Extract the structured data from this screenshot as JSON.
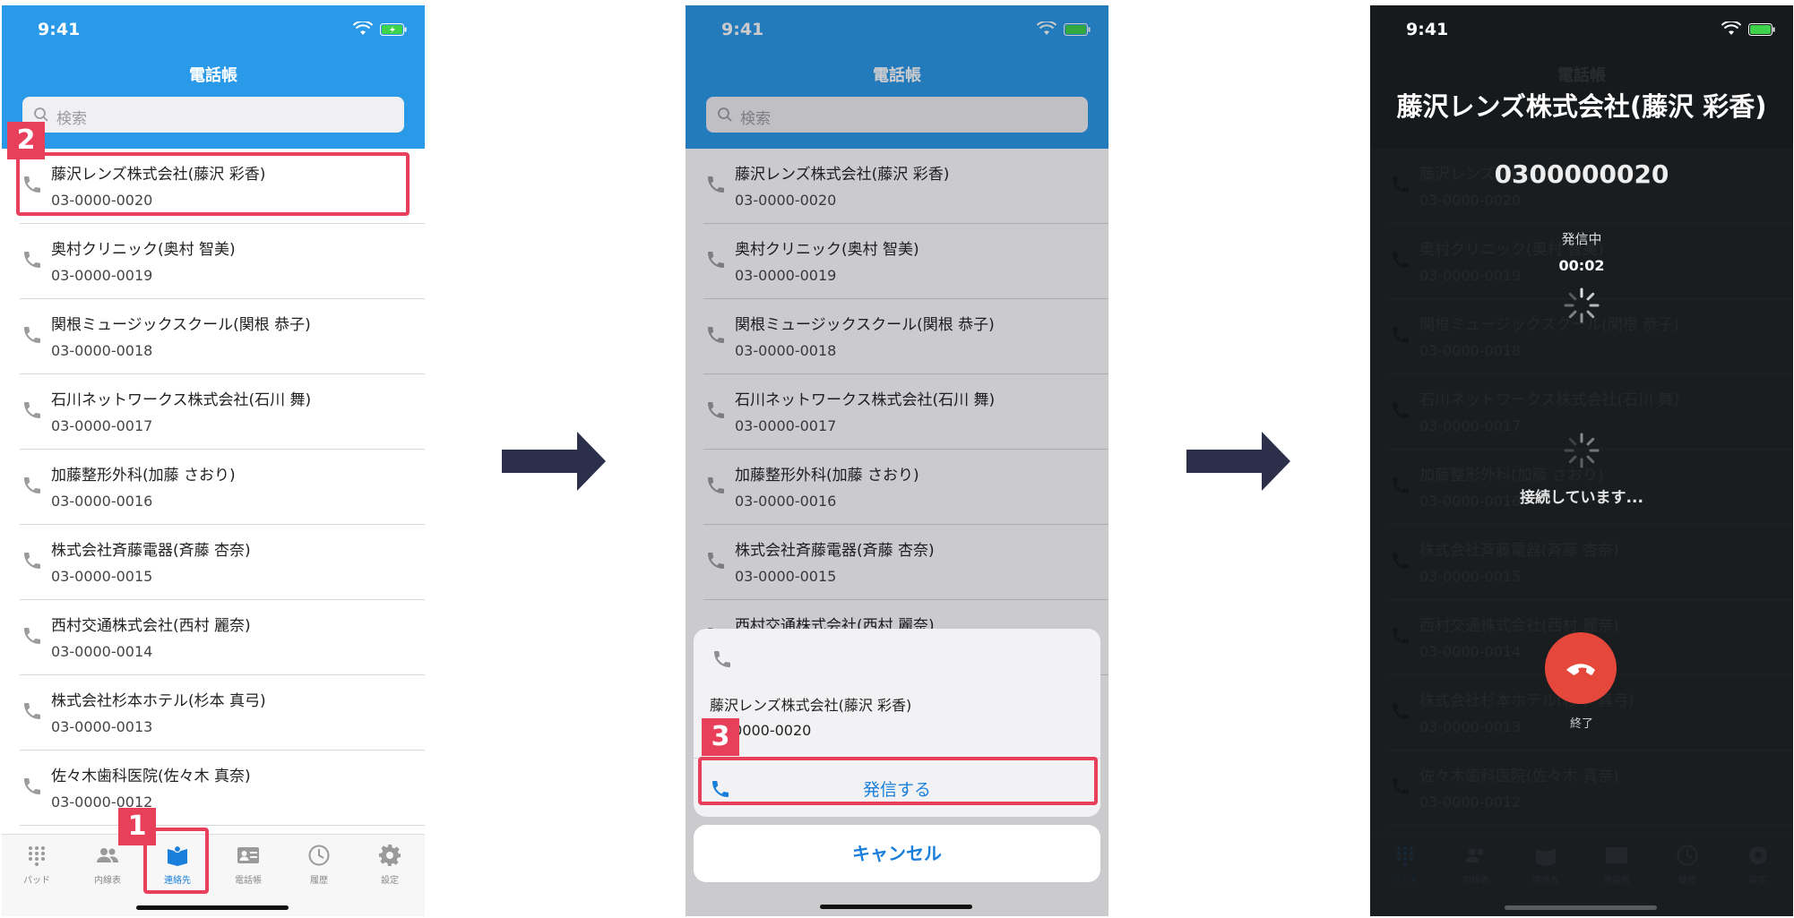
{
  "status": {
    "time": "9:41"
  },
  "header_title": "電話帳",
  "search_placeholder": "検索",
  "contacts": [
    {
      "name": "藤沢レンズ株式会社(藤沢 彩香)",
      "number": "03-0000-0020"
    },
    {
      "name": "奥村クリニック(奥村 智美)",
      "number": "03-0000-0019"
    },
    {
      "name": "関根ミュージックスクール(関根 恭子)",
      "number": "03-0000-0018"
    },
    {
      "name": "石川ネットワークス株式会社(石川 舞)",
      "number": "03-0000-0017"
    },
    {
      "name": "加藤整形外科(加藤 さおり)",
      "number": "03-0000-0016"
    },
    {
      "name": "株式会社斉藤電器(斉藤 杏奈)",
      "number": "03-0000-0015"
    },
    {
      "name": "西村交通株式会社(西村 麗奈)",
      "number": "03-0000-0014"
    },
    {
      "name": "株式会社杉本ホテル(杉本 真弓)",
      "number": "03-0000-0013"
    },
    {
      "name": "佐々木歯科医院(佐々木 真奈)",
      "number": "03-0000-0012"
    }
  ],
  "tabs": [
    {
      "label": "パッド",
      "icon": "keypad-icon"
    },
    {
      "label": "内線表",
      "icon": "people-icon"
    },
    {
      "label": "連絡先",
      "icon": "contacts-book-icon"
    },
    {
      "label": "電話帳",
      "icon": "phonebook-card-icon"
    },
    {
      "label": "履歴",
      "icon": "clock-icon"
    },
    {
      "label": "設定",
      "icon": "gear-icon"
    }
  ],
  "markers": {
    "m1": "1",
    "m2": "2",
    "m3": "3"
  },
  "sheet": {
    "name": "藤沢レンズ株式会社(藤沢 彩香)",
    "number": "03-0000-0020",
    "call_label": "発信する",
    "cancel_label": "キャンセル"
  },
  "call": {
    "name": "藤沢レンズ株式会社(藤沢 彩香)",
    "number": "0300000020",
    "state": "発信中",
    "timer": "00:02",
    "connecting": "接続しています...",
    "end_label": "終了"
  },
  "colors": {
    "accent": "#2a99e8",
    "link": "#1a7fdb",
    "marker": "#e8405a",
    "end": "#e6473b",
    "arrow": "#2b2f4a"
  }
}
